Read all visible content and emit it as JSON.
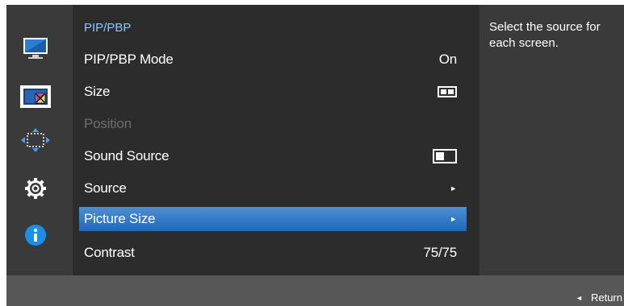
{
  "menu": {
    "title": "PIP/PBP",
    "items": [
      {
        "label": "PIP/PBP Mode",
        "value": "On"
      },
      {
        "label": "Size"
      },
      {
        "label": "Position"
      },
      {
        "label": "Sound Source"
      },
      {
        "label": "Source"
      },
      {
        "label": "Picture Size"
      },
      {
        "label": "Contrast",
        "value": "75/75"
      }
    ]
  },
  "sidebar": {
    "icons": [
      "monitor-icon",
      "picture-color-icon",
      "position-arrows-icon",
      "settings-gear-icon",
      "info-icon"
    ],
    "selected_index": 1
  },
  "help": {
    "text": "Select the source for each screen."
  },
  "footer": {
    "return_label": "Return"
  },
  "colors": {
    "highlight": "#2f7bcb",
    "title": "#8ec8ff",
    "disabled": "#6e6e6e",
    "info_blue": "#1a8fe8"
  }
}
